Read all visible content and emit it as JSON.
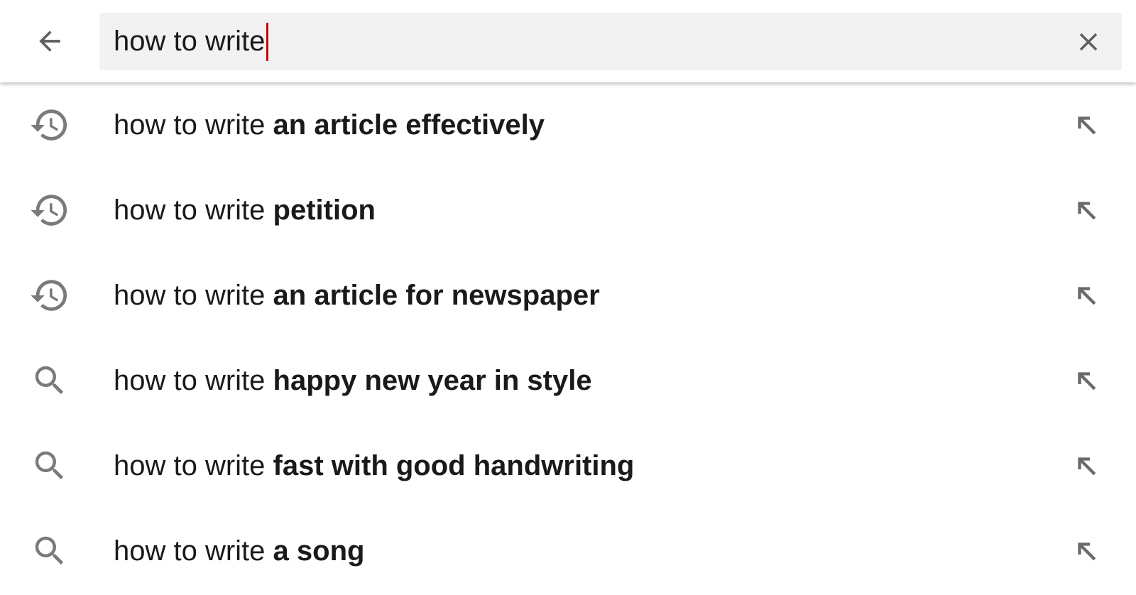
{
  "search": {
    "value": "how to write",
    "caret_color": "#cc0000"
  },
  "icons": {
    "back": "arrow-back-icon",
    "clear": "close-icon",
    "history": "history-icon",
    "search": "search-icon",
    "fill": "arrow-north-west-icon"
  },
  "suggestions": [
    {
      "icon": "history-icon",
      "prefix": "how to write ",
      "completion": "an article effectively"
    },
    {
      "icon": "history-icon",
      "prefix": "how to write ",
      "completion": "petition"
    },
    {
      "icon": "history-icon",
      "prefix": "how to write ",
      "completion": "an article for newspaper"
    },
    {
      "icon": "search-icon",
      "prefix": "how to write ",
      "completion": "happy new year in style"
    },
    {
      "icon": "search-icon",
      "prefix": "how to write ",
      "completion": "fast with good handwriting"
    },
    {
      "icon": "search-icon",
      "prefix": "how to write ",
      "completion": "a song"
    }
  ]
}
